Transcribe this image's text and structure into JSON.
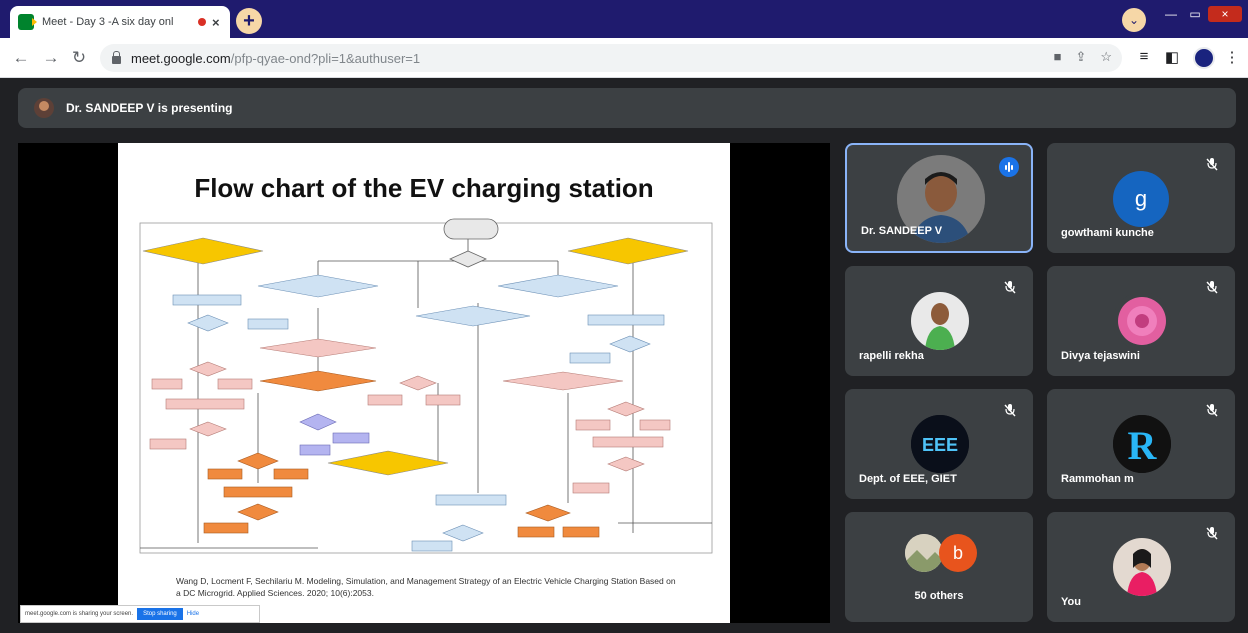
{
  "browser": {
    "tab_title": "Meet - Day 3 -A six day onl",
    "tab_close": "×",
    "new_tab": "+",
    "tab_search": "⌄",
    "win_min": "—",
    "win_max": "▭",
    "win_close": "×",
    "url_host": "meet.google.com",
    "url_path": "/pfp-qyae-ond?pli=1&authuser=1"
  },
  "meet": {
    "presenting_text": "Dr. SANDEEP V is presenting",
    "slide": {
      "title": "Flow chart of the EV charging station",
      "citation": "Wang D, Locment F, Sechilariu M. Modeling, Simulation, and Management Strategy of an Electric Vehicle Charging Station Based on a DC Microgrid. Applied Sciences. 2020; 10(6):2053."
    },
    "share_bar": {
      "text": "meet.google.com is sharing your screen.",
      "stop_label": "Stop sharing",
      "hide_label": "Hide"
    },
    "participants": [
      {
        "name": "Dr. SANDEEP V"
      },
      {
        "name": "gowthami kunche",
        "initial": "g"
      },
      {
        "name": "rapelli rekha"
      },
      {
        "name": "Divya tejaswini"
      },
      {
        "name": "Dept. of EEE, GIET",
        "logo_text": "EEE"
      },
      {
        "name": "Rammohan m",
        "logo_text": "R"
      },
      {
        "name": "50 others",
        "initial": "b"
      },
      {
        "name": "You"
      }
    ]
  },
  "colors": {
    "tabstrip": "#1f1b6e",
    "meet_bg": "#202124",
    "tile_bg": "#3c4043",
    "active_border": "#8ab4f8",
    "accent_blue": "#1a73e8"
  }
}
